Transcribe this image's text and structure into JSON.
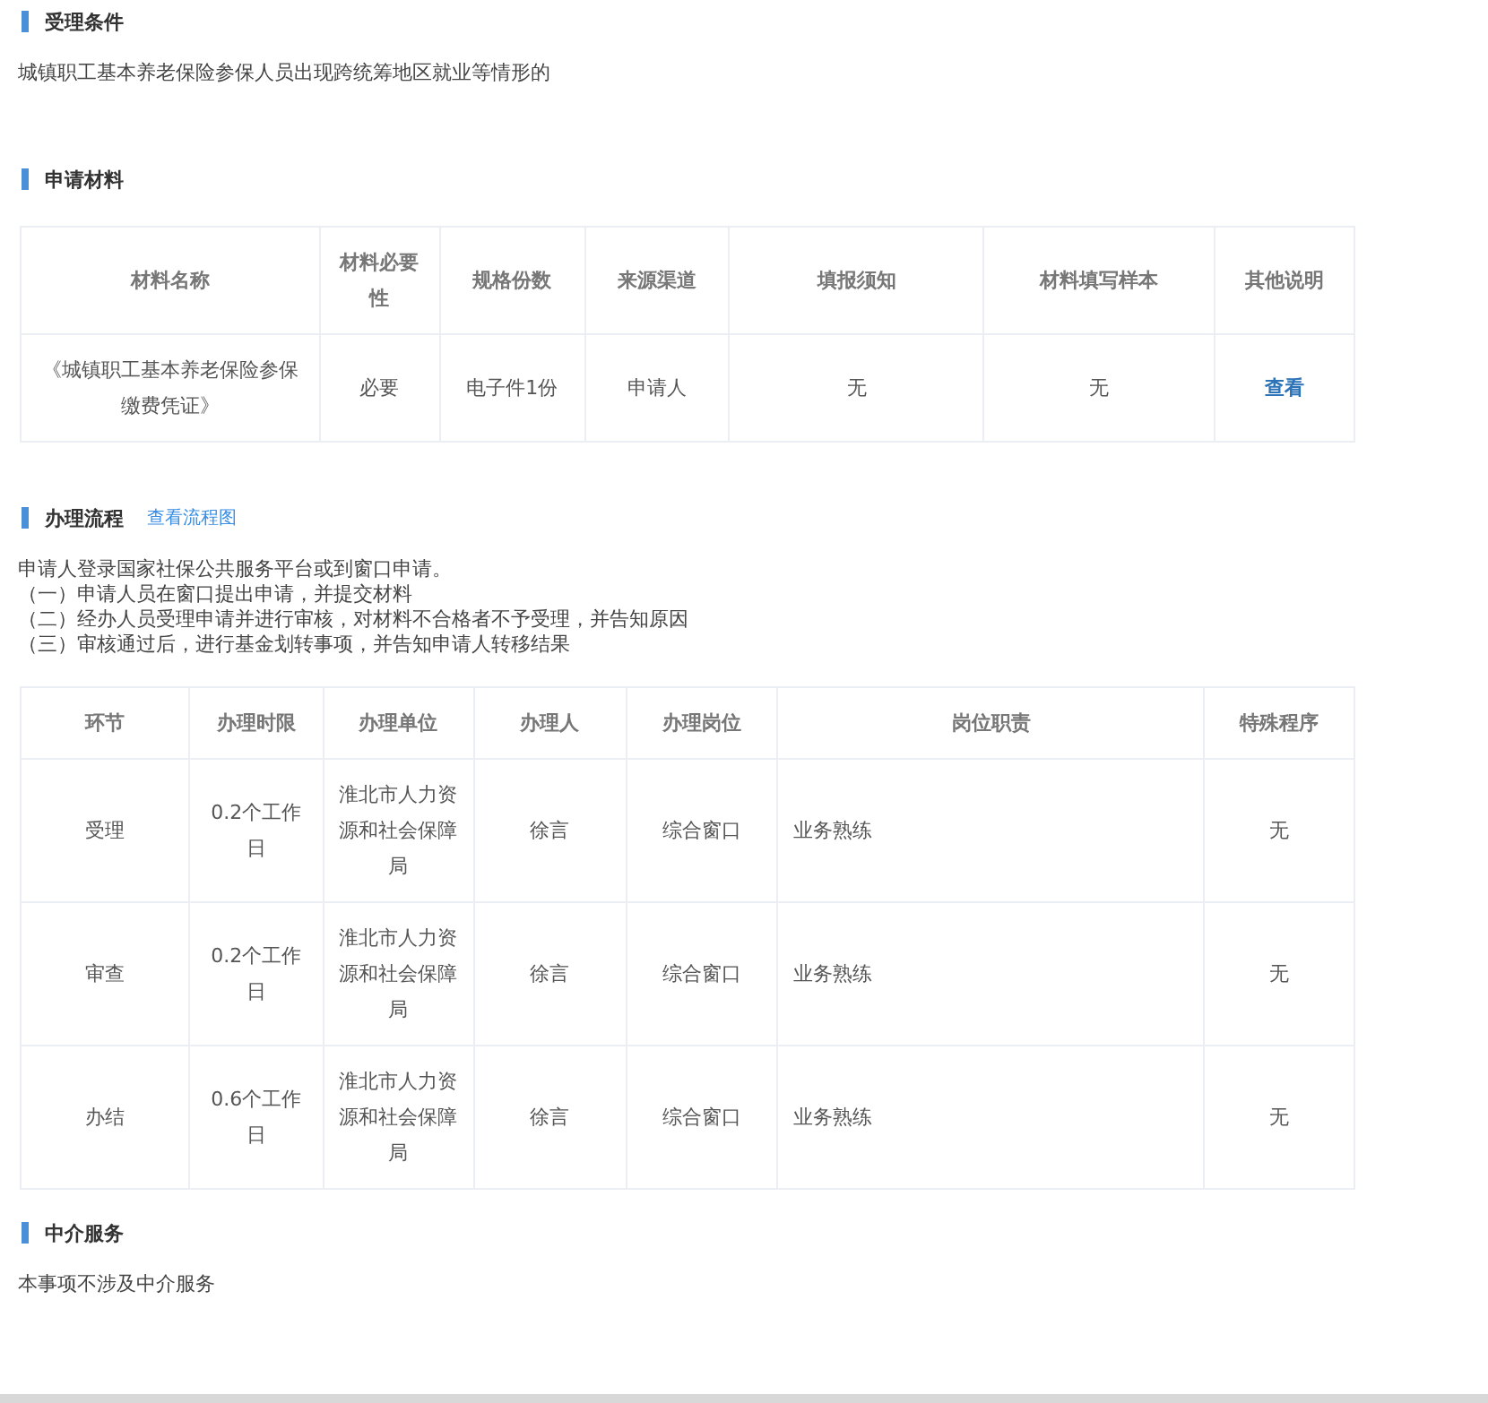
{
  "sections": [
    {
      "kind": "text",
      "title": "受理条件",
      "paragraphs": [
        "城镇职工基本养老保险参保人员出现跨统筹地区就业等情形的"
      ]
    },
    {
      "kind": "materials",
      "title": "申请材料",
      "table": {
        "columns": [
          "材料名称",
          "材料必要性",
          "规格份数",
          "来源渠道",
          "填报须知",
          "材料填写样本",
          "其他说明"
        ],
        "rows": [
          {
            "cells": [
              "《城镇职工基本养老保险参保缴费凭证》",
              "必要",
              "电子件1份",
              "申请人",
              "无",
              "无"
            ],
            "link": "查看"
          }
        ]
      }
    },
    {
      "kind": "process",
      "title": "办理流程",
      "link": "查看流程图",
      "paragraphs": [
        "申请人登录国家社保公共服务平台或到窗口申请。",
        "（一）申请人员在窗口提出申请，并提交材料",
        "（二）经办人员受理申请并进行审核，对材料不合格者不予受理，并告知原因",
        "（三）审核通过后，进行基金划转事项，并告知申请人转移结果"
      ],
      "table": {
        "columns": [
          "环节",
          "办理时限",
          "办理单位",
          "办理人",
          "办理岗位",
          "岗位职责",
          "特殊程序"
        ],
        "rows": [
          {
            "cells": [
              "受理",
              "0.2个工作日",
              "淮北市人力资源和社会保障局",
              "徐言",
              "综合窗口",
              "业务熟练",
              "无"
            ]
          },
          {
            "cells": [
              "审查",
              "0.2个工作日",
              "淮北市人力资源和社会保障局",
              "徐言",
              "综合窗口",
              "业务熟练",
              "无"
            ]
          },
          {
            "cells": [
              "办结",
              "0.6个工作日",
              "淮北市人力资源和社会保障局",
              "徐言",
              "综合窗口",
              "业务熟练",
              "无"
            ]
          }
        ]
      }
    },
    {
      "kind": "text",
      "title": "中介服务",
      "paragraphs": [
        "本事项不涉及中介服务"
      ]
    }
  ]
}
